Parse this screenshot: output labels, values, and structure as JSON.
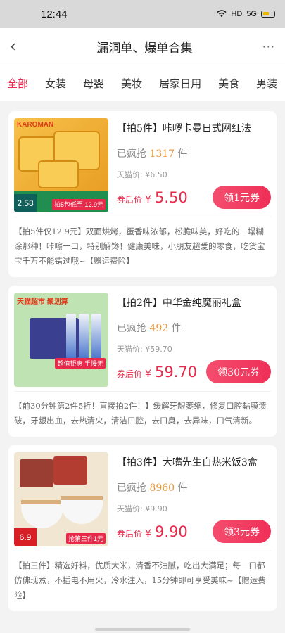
{
  "status": {
    "time": "12:44",
    "network": "HD",
    "signal": "5G"
  },
  "nav": {
    "back_icon": "‹",
    "title": "漏洞单、爆单合集",
    "more_icon": "···"
  },
  "tabs": [
    "全部",
    "女装",
    "母婴",
    "美妆",
    "居家日用",
    "美食",
    "男装"
  ],
  "active_tab": 0,
  "products": [
    {
      "title": "【拍5件】咔啰卡曼日式网红法",
      "sold_prefix": "已疯抢",
      "sold_count": "1317",
      "sold_unit": "件",
      "orig_price": "天猫价: ¥6.50",
      "price_label": "券后价",
      "price_currency": "¥",
      "price": "5.50",
      "coupon": "领1元券",
      "desc": "【拍5件仅12.9元】双面烘烤，蛋香味浓郁，松脆味美，好吃的一塌糊涂那种！咔嚓一口，特别解馋！健康美味，小朋友超爱的零食，吃货宝宝千万不能错过哦~【赠运费险】",
      "thumb_badge": "2.58",
      "thumb_caption": "拍5包低至 12.9元",
      "thumb_tag": "KAROMAN"
    },
    {
      "title": "【拍2件】中华金纯魔丽礼盒",
      "sold_prefix": "已疯抢",
      "sold_count": "492",
      "sold_unit": "件",
      "orig_price": "天猫价: ¥59.70",
      "price_label": "券后价",
      "price_currency": "¥",
      "price": "59.70",
      "coupon": "领30元券",
      "desc": "【前30分钟第2件5折！直接拍2件！】缓解牙龈萎缩，修复口腔黏膜溃破，牙龈出血，去热清火，清洁口腔，去口臭，去异味，口气清新。",
      "thumb_badge": "",
      "thumb_caption": "超值钜惠 手慢无",
      "thumb_tag": "天猫超市 聚划算"
    },
    {
      "title": "【拍3件】大嘴先生自热米饭3盒",
      "sold_prefix": "已疯抢",
      "sold_count": "8960",
      "sold_unit": "件",
      "orig_price": "天猫价: ¥9.90",
      "price_label": "券后价",
      "price_currency": "¥",
      "price": "9.90",
      "coupon": "领3元券",
      "desc": "【拍三件】精选好料，优质大米，清香不油腻，吃出大满足；每一口都仿佛现煮，不插电不用火，冷水注入，15分钟即可享受美味~【赠运费险】",
      "thumb_badge": "6.9",
      "thumb_caption": "抢第三件1元",
      "thumb_tag": ""
    }
  ]
}
